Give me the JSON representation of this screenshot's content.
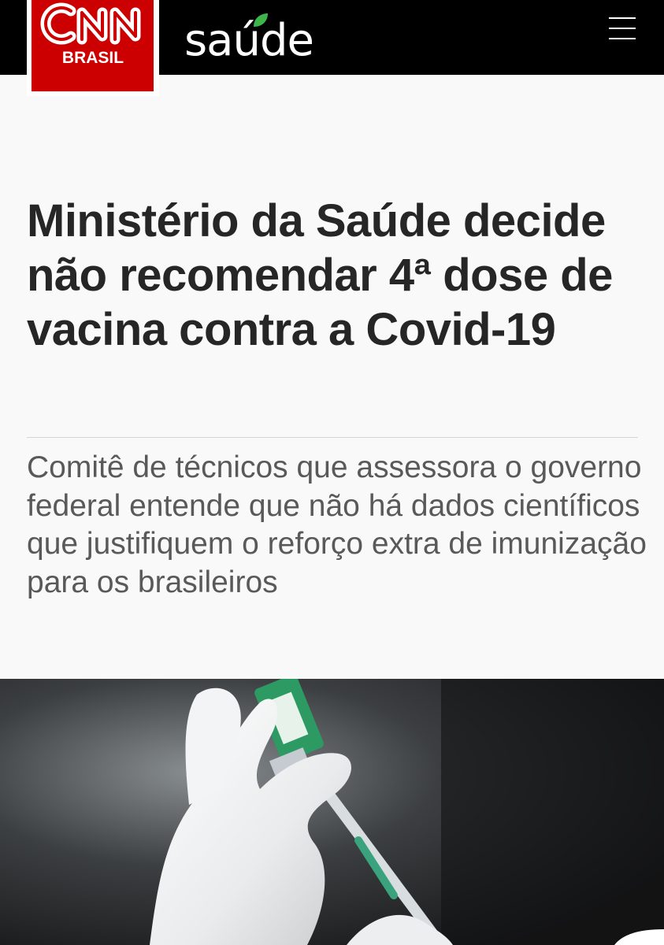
{
  "header": {
    "brand_logo_text": "BRASIL",
    "section_logo_text": "saúde",
    "menu_icon": "hamburger-menu-icon"
  },
  "article": {
    "headline": "Ministério da Saúde decide não recomendar 4ª dose de vacina contra a Covid-19",
    "subheadline": "Comitê de técnicos que assessora o governo federal entende que não há dados científicos que justifiquem o reforço extra de imunização para os brasileiros",
    "image": "vaccine-vial-syringe-photo"
  },
  "colors": {
    "topbar": "#000000",
    "brand_red": "#cc0000",
    "leaf_green": "#3db54a",
    "headline_text": "#262626",
    "subheadline_text": "#595959",
    "page_background": "#f9f9f9"
  }
}
